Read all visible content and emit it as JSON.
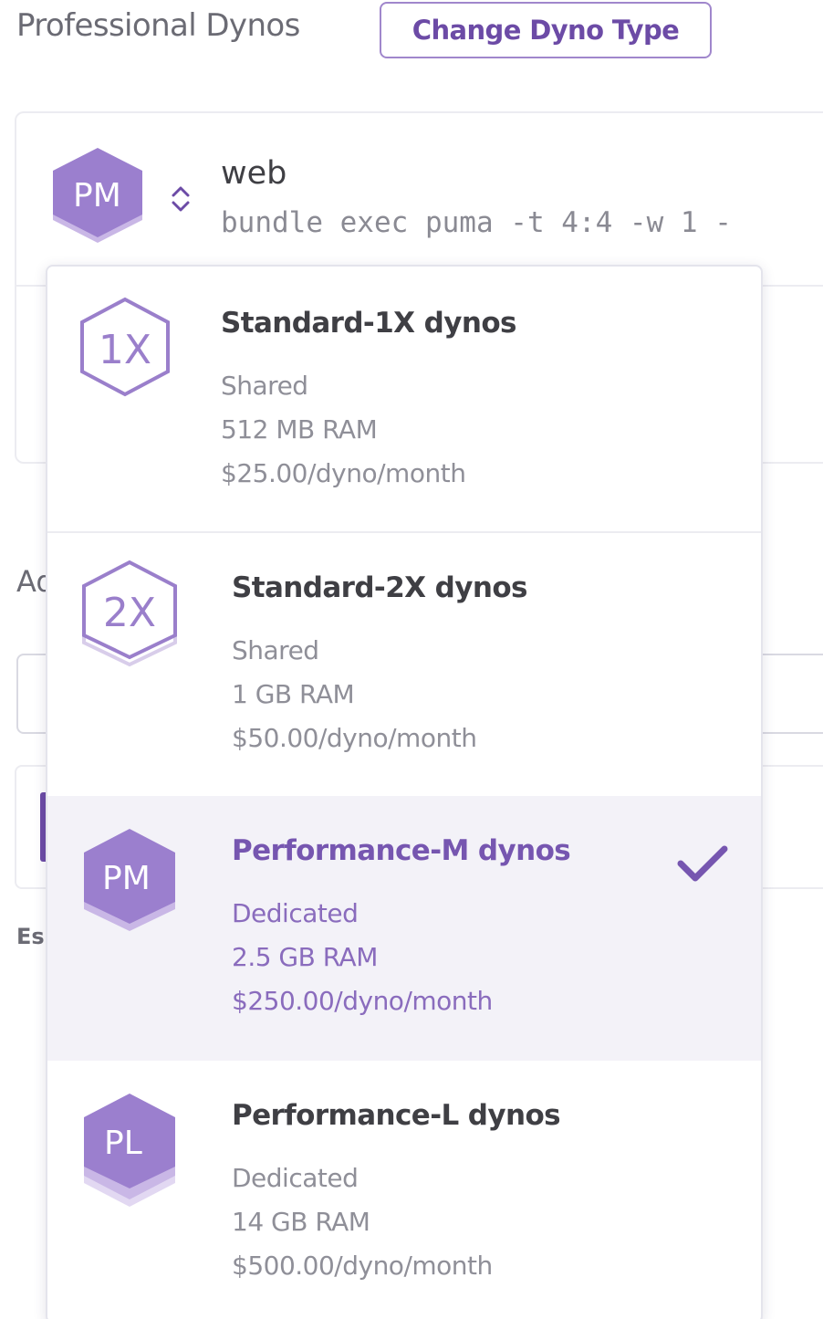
{
  "header": {
    "title": "Professional Dynos",
    "change_button": "Change Dyno Type"
  },
  "process": {
    "badge": "PM",
    "name": "web",
    "command": "bundle exec puma -t 4:4 -w 1 -"
  },
  "background": {
    "label_partial": "Ad",
    "estimate_partial": "Es"
  },
  "dropdown": {
    "options": [
      {
        "icon": "1X",
        "title": "Standard-1X dynos",
        "type": "Shared",
        "ram": "512 MB RAM",
        "price": "$25.00/dyno/month",
        "selected": false
      },
      {
        "icon": "2X",
        "title": "Standard-2X dynos",
        "type": "Shared",
        "ram": "1 GB RAM",
        "price": "$50.00/dyno/month",
        "selected": false
      },
      {
        "icon": "PM",
        "title": "Performance-M dynos",
        "type": "Dedicated",
        "ram": "2.5 GB RAM",
        "price": "$250.00/dyno/month",
        "selected": true
      },
      {
        "icon": "PL",
        "title": "Performance-L dynos",
        "type": "Dedicated",
        "ram": "14 GB RAM",
        "price": "$500.00/dyno/month",
        "selected": false
      }
    ]
  },
  "colors": {
    "accent": "#7656b0",
    "badge_fill": "#9b7fce",
    "outline": "#9a7fcb"
  }
}
